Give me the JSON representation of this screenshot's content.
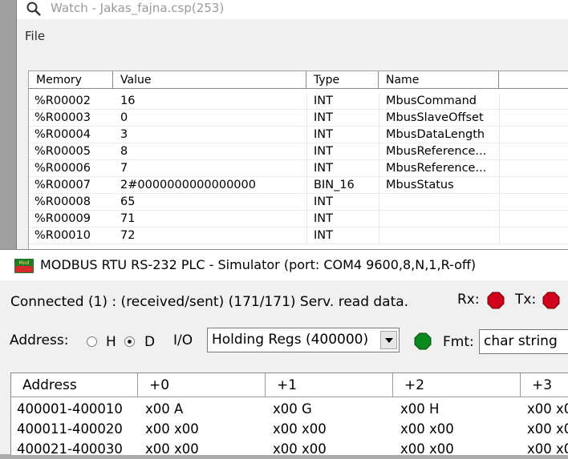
{
  "watch": {
    "title": "Watch - Jakas_fajna.csp(253)",
    "menu": [
      "File"
    ],
    "columns": [
      "Memory",
      "Value",
      "Type",
      "Name"
    ],
    "rows": [
      {
        "memory": "%R00002",
        "value": "16",
        "type": "INT",
        "name": "MbusCommand"
      },
      {
        "memory": "%R00003",
        "value": "0",
        "type": "INT",
        "name": "MbusSlaveOffset"
      },
      {
        "memory": "%R00004",
        "value": "3",
        "type": "INT",
        "name": "MbusDataLength"
      },
      {
        "memory": "%R00005",
        "value": "8",
        "type": "INT",
        "name": "MbusReference..."
      },
      {
        "memory": "%R00006",
        "value": "7",
        "type": "INT",
        "name": "MbusReference..."
      },
      {
        "memory": "%R00007",
        "value": "2#0000000000000000",
        "type": "BIN_16",
        "name": "MbusStatus"
      },
      {
        "memory": "%R00008",
        "value": "65",
        "type": "INT",
        "name": ""
      },
      {
        "memory": "%R00009",
        "value": "71",
        "type": "INT",
        "name": ""
      },
      {
        "memory": "%R00010",
        "value": "72",
        "type": "INT",
        "name": ""
      }
    ]
  },
  "modbus": {
    "icon_text": "Mod",
    "title": "MODBUS RTU RS-232 PLC - Simulator (port: COM4 9600,8,N,1,R-off)",
    "status": "Connected (1) : (received/sent) (171/171) Serv. read data.",
    "rx_label": "Rx:",
    "tx_label": "Tx:",
    "rx_color": "#d0021b",
    "tx_color": "#d0021b",
    "address_label": "Address:",
    "radio_h_label": "H",
    "radio_d_label": "D",
    "radio_selected": "D",
    "io_label": "I/O",
    "io_selected": "Holding Regs (400000)",
    "fmt_led_color": "#0a8a1e",
    "fmt_label": "Fmt:",
    "fmt_value": "char string",
    "columns": [
      "Address",
      "+0",
      "+1",
      "+2",
      "+3"
    ],
    "rows": [
      {
        "address": "400001-400010",
        "c0": "x00 A",
        "c1": "x00 G",
        "c2": "x00 H",
        "c3": "x00 x0"
      },
      {
        "address": "400011-400020",
        "c0": "x00 x00",
        "c1": "x00 x00",
        "c2": "x00 x00",
        "c3": "x00 x0"
      },
      {
        "address": "400021-400030",
        "c0": "x00 x00",
        "c1": "x00 x00",
        "c2": "x00 x00",
        "c3": "x00 x0"
      }
    ]
  }
}
